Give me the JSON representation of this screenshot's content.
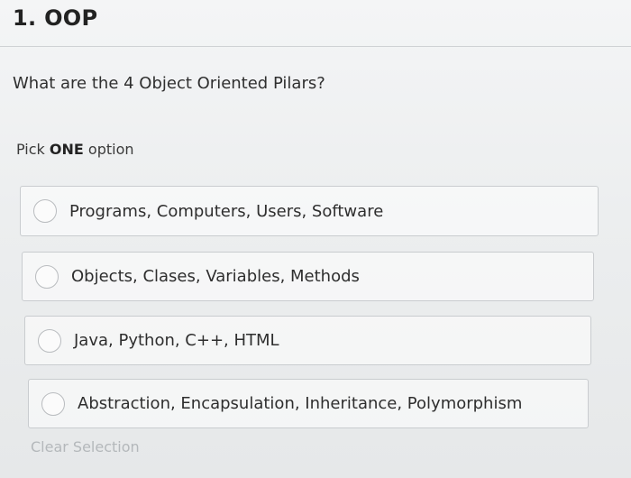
{
  "question_number_title": "1. OOP",
  "question_text": "What are the 4 Object Oriented Pilars?",
  "instruction": {
    "prefix": "Pick ",
    "emphasis": "ONE",
    "suffix": " option"
  },
  "options": [
    {
      "label": "Programs, Computers, Users, Software",
      "selected": false
    },
    {
      "label": "Objects, Clases, Variables, Methods",
      "selected": false
    },
    {
      "label": "Java, Python, C++, HTML",
      "selected": false
    },
    {
      "label": "Abstraction, Encapsulation, Inheritance, Polymorphism",
      "selected": false
    }
  ],
  "clear_selection_label": "Clear Selection"
}
